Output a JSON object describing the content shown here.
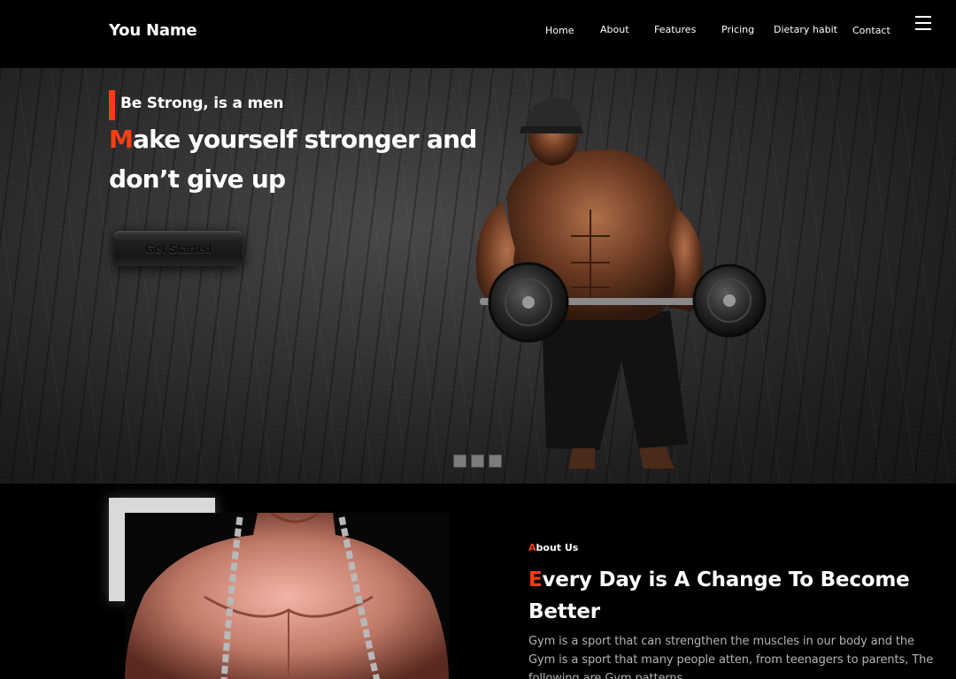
{
  "brand": {
    "name": "You Name"
  },
  "nav": {
    "links": [
      "Home",
      "About",
      "Features",
      "Pricing",
      "Dietary habit",
      "Contact"
    ],
    "menu_icon": "hamburger-menu-icon"
  },
  "hero": {
    "tagline": "Be Strong, is a men",
    "headline_first_letter": "M",
    "headline_rest": "ake yourself stronger and don’t give up",
    "cta_label": "Get Started",
    "slide_count": 3,
    "active_slide": 1,
    "image": "bodybuilder-barbell-curl"
  },
  "about": {
    "label_first_letter": "A",
    "label_rest": "bout Us",
    "title_first_letter": "E",
    "title_rest": "very Day is A Change To Become Better",
    "text": "Gym is a sport that can strengthen the muscles in our body and the Gym  is a sport that many people atten, from teenagers to parents, The following are Gym patterns",
    "image": "muscular-man-with-chains"
  },
  "colors": {
    "accent": "#ff3d12",
    "background": "#000000",
    "text": "#ffffff",
    "muted_text": "#b3b3b3"
  }
}
